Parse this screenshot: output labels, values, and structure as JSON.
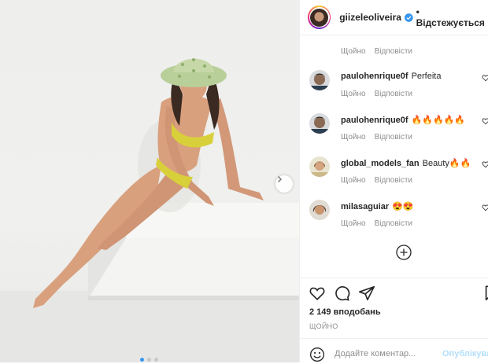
{
  "post": {
    "username": "giizeleoliveira",
    "follow_label": "• Відстежується",
    "verified_color": "#3897f0"
  },
  "first_meta": {
    "time": "Щойно",
    "reply": "Відповісти"
  },
  "comments": [
    {
      "user": "paulohenrique0f",
      "text": "Perfeita",
      "time": "Щойно",
      "reply": "Відповісти"
    },
    {
      "user": "paulohenrique0f",
      "text": "🔥🔥🔥🔥🔥",
      "time": "Щойно",
      "reply": "Відповісти"
    },
    {
      "user": "global_models_fan",
      "text": "Beauty🔥🔥",
      "time": "Щойно",
      "reply": "Відповісти"
    },
    {
      "user": "milasaguiar",
      "text": "😍😍",
      "time": "Щойно",
      "reply": "Відповісти"
    }
  ],
  "stats": {
    "likes": "2 149 вподобань",
    "posted": "ЩОЙНО"
  },
  "composer": {
    "placeholder": "Додайте коментар...",
    "post_label": "Опублікува"
  },
  "icons": [
    "next-arrow-icon",
    "heart-icon",
    "comment-icon",
    "share-icon",
    "bookmark-icon",
    "plus-circle-icon",
    "emoji-icon",
    "verified-badge-icon"
  ],
  "colors": {
    "accent": "#3897f0",
    "muted": "#8e8e8e",
    "post_disabled": "#b2dffc",
    "swimsuit": "#d8d03a"
  },
  "carousel": {
    "total": 3,
    "active": 1
  }
}
